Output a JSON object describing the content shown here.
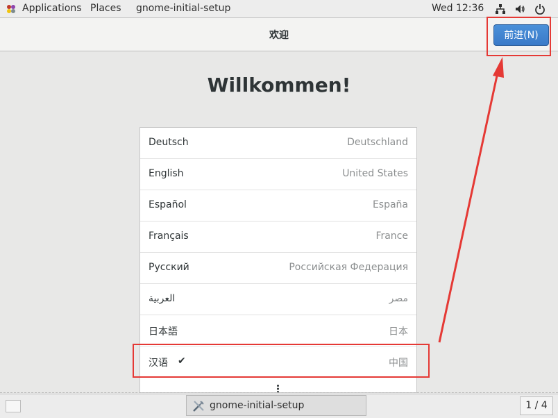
{
  "top_panel": {
    "applications": "Applications",
    "places": "Places",
    "app_name": "gnome-initial-setup",
    "clock": "Wed 12:36"
  },
  "header": {
    "title": "欢迎",
    "next_button": "前进(N)"
  },
  "main": {
    "welcome": "Willkommen!",
    "languages": [
      {
        "name": "Deutsch",
        "region": "Deutschland"
      },
      {
        "name": "English",
        "region": "United States"
      },
      {
        "name": "Español",
        "region": "España"
      },
      {
        "name": "Français",
        "region": "France"
      },
      {
        "name": "Русский",
        "region": "Российская Федерация"
      },
      {
        "name": "العربية",
        "region": "مصر"
      },
      {
        "name": "日本語",
        "region": "日本"
      },
      {
        "name": "汉语",
        "region": "中国",
        "selected": true
      }
    ],
    "selected_mark": "✔"
  },
  "taskbar": {
    "task_label": "gnome-initial-setup",
    "workspace": "1 / 4"
  },
  "colors": {
    "accent": "#3a7ac8",
    "annotation": "#e53935"
  }
}
